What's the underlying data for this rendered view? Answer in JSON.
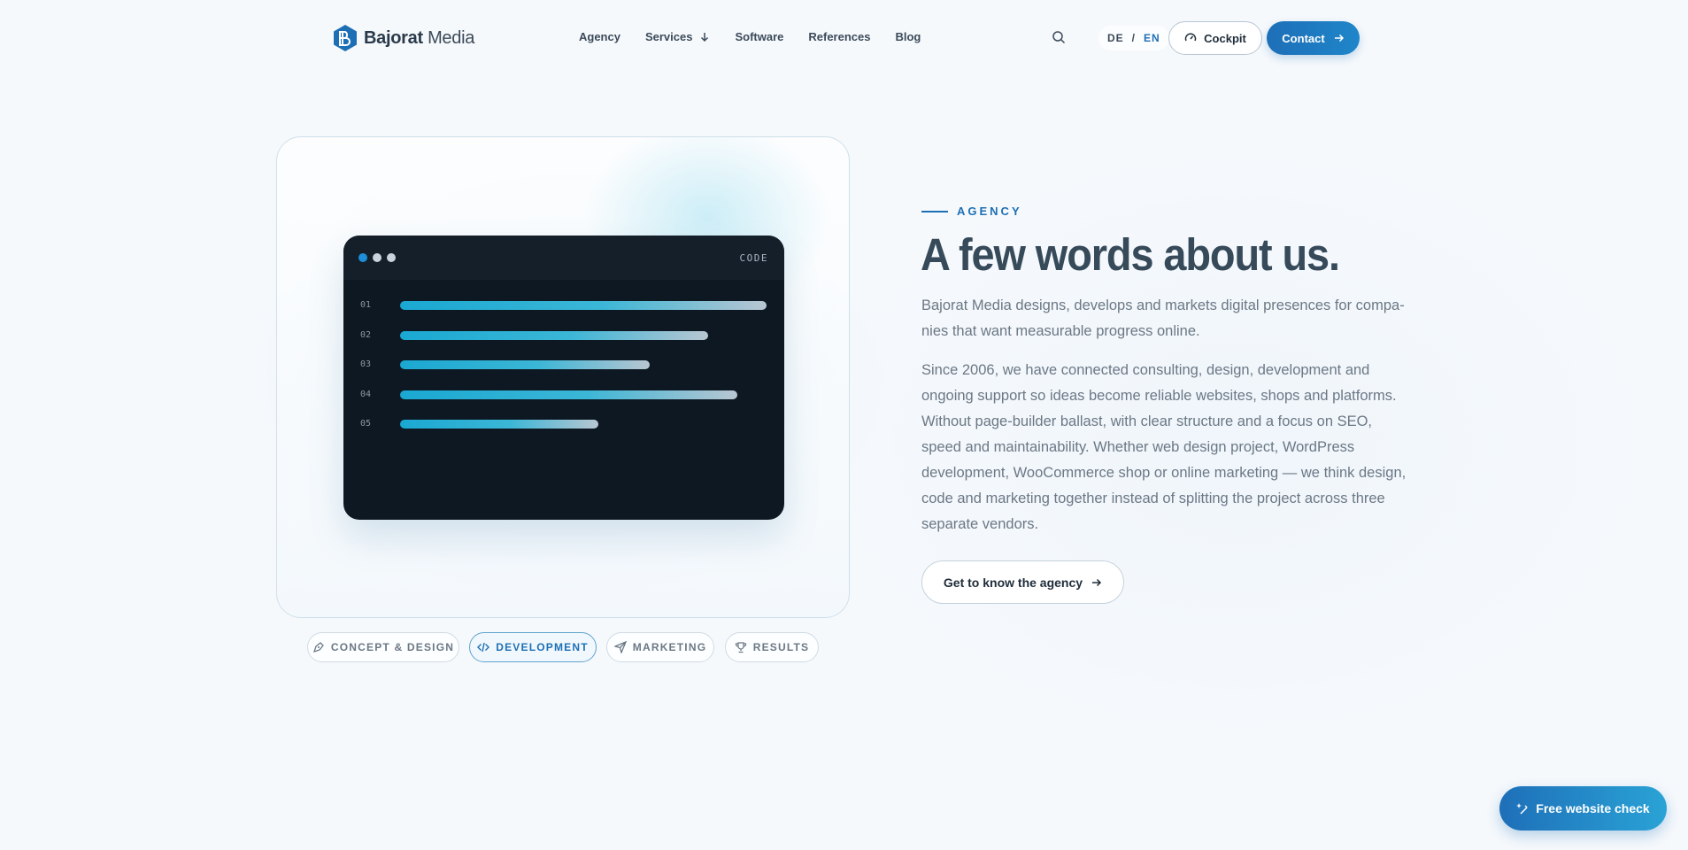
{
  "header": {
    "logo": {
      "brand_bold": "Bajorat",
      "brand_light": " Media",
      "icon": "bajorat-logo-icon"
    },
    "nav": [
      {
        "label": "Agency"
      },
      {
        "label": "Services",
        "icon": "arrow-down-icon"
      },
      {
        "label": "Software"
      },
      {
        "label": "References"
      },
      {
        "label": "Blog"
      }
    ],
    "search_icon": "search-icon",
    "lang": {
      "de": "DE",
      "sep": "/",
      "en": "EN",
      "active": "EN"
    },
    "cockpit_label": "Cockpit",
    "contact_label": "Contact"
  },
  "visual": {
    "code_label": "CODE",
    "dots": [
      "#1d8fd8",
      "#c9d3dc",
      "#c9d3dc"
    ],
    "lines": [
      {
        "num": "01",
        "fill": 1.0
      },
      {
        "num": "02",
        "fill": 0.84
      },
      {
        "num": "03",
        "fill": 0.68
      },
      {
        "num": "04",
        "fill": 0.92
      },
      {
        "num": "05",
        "fill": 0.54
      }
    ],
    "chips": [
      {
        "label": "CONCEPT & DESIGN",
        "icon": "pen-tool-icon",
        "active": false
      },
      {
        "label": "DEVELOPMENT",
        "icon": "code-icon",
        "active": true
      },
      {
        "label": "MARKETING",
        "icon": "send-icon",
        "active": false
      },
      {
        "label": "RESULTS",
        "icon": "trophy-icon",
        "active": false
      }
    ]
  },
  "content": {
    "eyebrow": "AGENCY",
    "heading": "A few words about us.",
    "para1": "Bajorat Media designs, develops and markets digital presences for compa­nies that want measurable progress online.",
    "para2": "Since 2006, we have connected consulting, design, development and ongo­ing support so ideas become reliable websites, shops and platforms. Without page-builder ballast, with clear structure and a focus on SEO, speed and maintainability. Whether web design project, WordPress development, WooCommerce shop or online marketing — we think design, code and mar­keting together instead of splitting the project across three separate vendors.",
    "cta_label": "Get to know the agency"
  },
  "floating": {
    "free_check_label": "Free website check",
    "icon": "sparkle-icon"
  },
  "colors": {
    "accent": "#1d6fb5",
    "heading": "#364a5a",
    "body": "#6b7885",
    "code_bg": "#0e1822"
  }
}
